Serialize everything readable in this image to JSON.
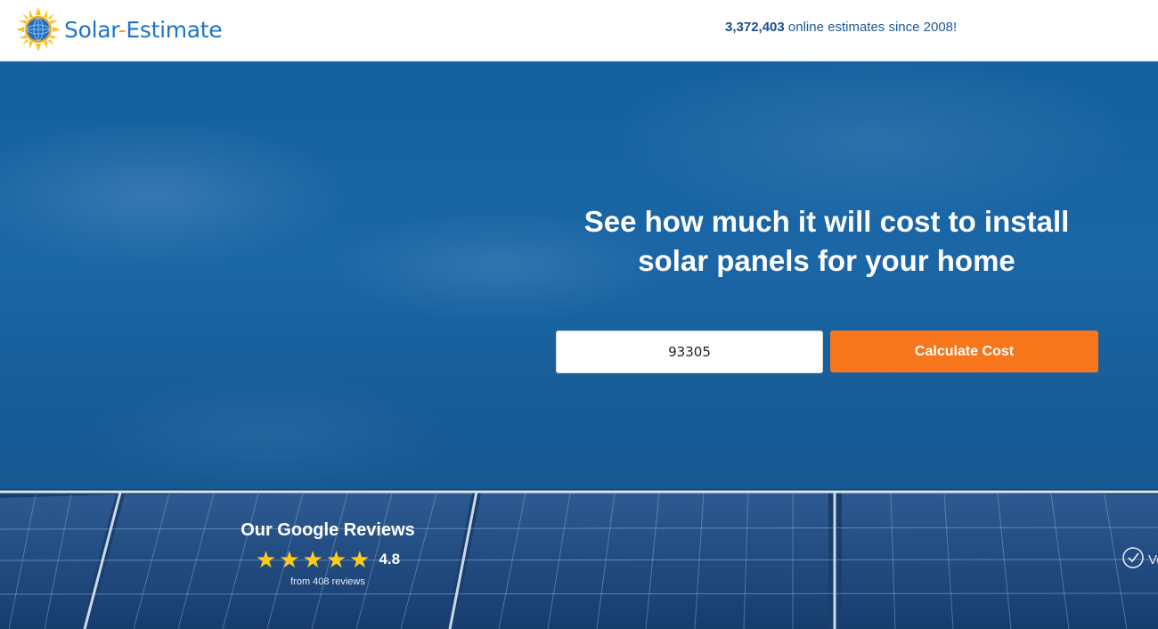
{
  "header": {
    "logo": {
      "part1": "Solar",
      "part2": "-",
      "part3": "Estimate"
    },
    "counter": {
      "number": "3,372,403",
      "text": " online estimates since 2008!"
    }
  },
  "hero": {
    "headline_line1": "See how much it will cost to install",
    "headline_line2": "solar panels for your home",
    "zip_input": {
      "value": "93305",
      "placeholder": ""
    },
    "cta_label": "Calculate Cost"
  },
  "reviews": {
    "title": "Our Google Reviews",
    "stars": 5,
    "rating": "4.8",
    "count_text": "from 408 reviews"
  },
  "badge": {
    "text": "Ve",
    "icon": "check-circle-icon"
  },
  "colors": {
    "brand_blue": "#1f74c6",
    "brand_orange": "#f39b1f",
    "cta_orange": "#f7761c",
    "star_yellow": "#ffcc1a"
  }
}
